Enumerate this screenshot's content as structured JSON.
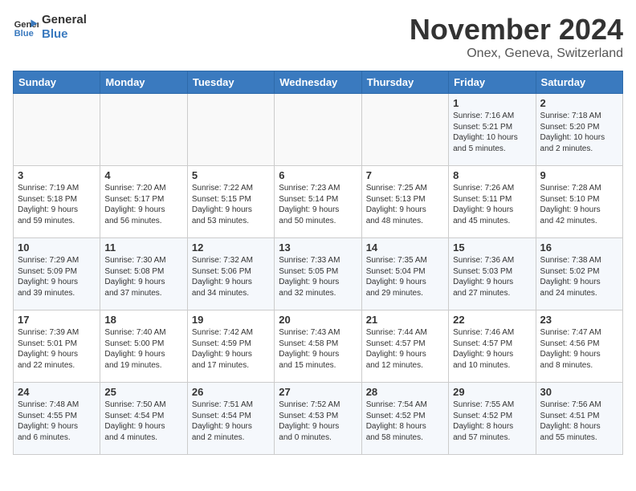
{
  "logo": {
    "line1": "General",
    "line2": "Blue"
  },
  "title": "November 2024",
  "subtitle": "Onex, Geneva, Switzerland",
  "headers": [
    "Sunday",
    "Monday",
    "Tuesday",
    "Wednesday",
    "Thursday",
    "Friday",
    "Saturday"
  ],
  "weeks": [
    [
      {
        "day": "",
        "info": ""
      },
      {
        "day": "",
        "info": ""
      },
      {
        "day": "",
        "info": ""
      },
      {
        "day": "",
        "info": ""
      },
      {
        "day": "",
        "info": ""
      },
      {
        "day": "1",
        "info": "Sunrise: 7:16 AM\nSunset: 5:21 PM\nDaylight: 10 hours\nand 5 minutes."
      },
      {
        "day": "2",
        "info": "Sunrise: 7:18 AM\nSunset: 5:20 PM\nDaylight: 10 hours\nand 2 minutes."
      }
    ],
    [
      {
        "day": "3",
        "info": "Sunrise: 7:19 AM\nSunset: 5:18 PM\nDaylight: 9 hours\nand 59 minutes."
      },
      {
        "day": "4",
        "info": "Sunrise: 7:20 AM\nSunset: 5:17 PM\nDaylight: 9 hours\nand 56 minutes."
      },
      {
        "day": "5",
        "info": "Sunrise: 7:22 AM\nSunset: 5:15 PM\nDaylight: 9 hours\nand 53 minutes."
      },
      {
        "day": "6",
        "info": "Sunrise: 7:23 AM\nSunset: 5:14 PM\nDaylight: 9 hours\nand 50 minutes."
      },
      {
        "day": "7",
        "info": "Sunrise: 7:25 AM\nSunset: 5:13 PM\nDaylight: 9 hours\nand 48 minutes."
      },
      {
        "day": "8",
        "info": "Sunrise: 7:26 AM\nSunset: 5:11 PM\nDaylight: 9 hours\nand 45 minutes."
      },
      {
        "day": "9",
        "info": "Sunrise: 7:28 AM\nSunset: 5:10 PM\nDaylight: 9 hours\nand 42 minutes."
      }
    ],
    [
      {
        "day": "10",
        "info": "Sunrise: 7:29 AM\nSunset: 5:09 PM\nDaylight: 9 hours\nand 39 minutes."
      },
      {
        "day": "11",
        "info": "Sunrise: 7:30 AM\nSunset: 5:08 PM\nDaylight: 9 hours\nand 37 minutes."
      },
      {
        "day": "12",
        "info": "Sunrise: 7:32 AM\nSunset: 5:06 PM\nDaylight: 9 hours\nand 34 minutes."
      },
      {
        "day": "13",
        "info": "Sunrise: 7:33 AM\nSunset: 5:05 PM\nDaylight: 9 hours\nand 32 minutes."
      },
      {
        "day": "14",
        "info": "Sunrise: 7:35 AM\nSunset: 5:04 PM\nDaylight: 9 hours\nand 29 minutes."
      },
      {
        "day": "15",
        "info": "Sunrise: 7:36 AM\nSunset: 5:03 PM\nDaylight: 9 hours\nand 27 minutes."
      },
      {
        "day": "16",
        "info": "Sunrise: 7:38 AM\nSunset: 5:02 PM\nDaylight: 9 hours\nand 24 minutes."
      }
    ],
    [
      {
        "day": "17",
        "info": "Sunrise: 7:39 AM\nSunset: 5:01 PM\nDaylight: 9 hours\nand 22 minutes."
      },
      {
        "day": "18",
        "info": "Sunrise: 7:40 AM\nSunset: 5:00 PM\nDaylight: 9 hours\nand 19 minutes."
      },
      {
        "day": "19",
        "info": "Sunrise: 7:42 AM\nSunset: 4:59 PM\nDaylight: 9 hours\nand 17 minutes."
      },
      {
        "day": "20",
        "info": "Sunrise: 7:43 AM\nSunset: 4:58 PM\nDaylight: 9 hours\nand 15 minutes."
      },
      {
        "day": "21",
        "info": "Sunrise: 7:44 AM\nSunset: 4:57 PM\nDaylight: 9 hours\nand 12 minutes."
      },
      {
        "day": "22",
        "info": "Sunrise: 7:46 AM\nSunset: 4:57 PM\nDaylight: 9 hours\nand 10 minutes."
      },
      {
        "day": "23",
        "info": "Sunrise: 7:47 AM\nSunset: 4:56 PM\nDaylight: 9 hours\nand 8 minutes."
      }
    ],
    [
      {
        "day": "24",
        "info": "Sunrise: 7:48 AM\nSunset: 4:55 PM\nDaylight: 9 hours\nand 6 minutes."
      },
      {
        "day": "25",
        "info": "Sunrise: 7:50 AM\nSunset: 4:54 PM\nDaylight: 9 hours\nand 4 minutes."
      },
      {
        "day": "26",
        "info": "Sunrise: 7:51 AM\nSunset: 4:54 PM\nDaylight: 9 hours\nand 2 minutes."
      },
      {
        "day": "27",
        "info": "Sunrise: 7:52 AM\nSunset: 4:53 PM\nDaylight: 9 hours\nand 0 minutes."
      },
      {
        "day": "28",
        "info": "Sunrise: 7:54 AM\nSunset: 4:52 PM\nDaylight: 8 hours\nand 58 minutes."
      },
      {
        "day": "29",
        "info": "Sunrise: 7:55 AM\nSunset: 4:52 PM\nDaylight: 8 hours\nand 57 minutes."
      },
      {
        "day": "30",
        "info": "Sunrise: 7:56 AM\nSunset: 4:51 PM\nDaylight: 8 hours\nand 55 minutes."
      }
    ]
  ]
}
